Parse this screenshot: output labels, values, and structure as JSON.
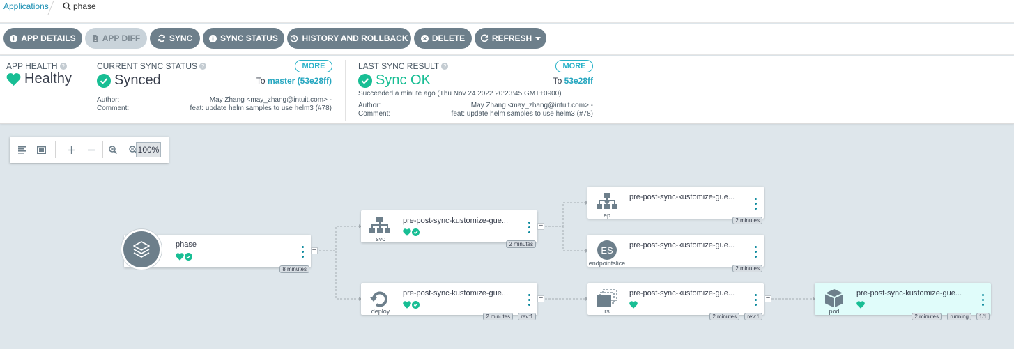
{
  "breadcrumb": {
    "applications": "Applications",
    "current": "phase"
  },
  "toolbar": {
    "app_details": "APP DETAILS",
    "app_diff": "APP DIFF",
    "sync": "SYNC",
    "sync_status": "SYNC STATUS",
    "history": "HISTORY AND ROLLBACK",
    "delete": "DELETE",
    "refresh": "REFRESH"
  },
  "health": {
    "title": "APP HEALTH",
    "value": "Healthy"
  },
  "current_sync": {
    "title": "CURRENT SYNC STATUS",
    "value": "Synced",
    "more": "MORE",
    "to_prefix": "To",
    "revision": "master (53e28ff)",
    "author_label": "Author:",
    "author": "May Zhang <may_zhang@intuit.com> -",
    "comment_label": "Comment:",
    "comment": "feat: update helm samples to use helm3 (#78)"
  },
  "last_sync": {
    "title": "LAST SYNC RESULT",
    "value": "Sync OK",
    "more": "MORE",
    "to_prefix": "To",
    "revision": "53e28ff",
    "succeeded": "Succeeded a minute ago (Thu Nov 24 2022 20:23:45 GMT+0900)",
    "author_label": "Author:",
    "author": "May Zhang <may_zhang@intuit.com> -",
    "comment_label": "Comment:",
    "comment": "feat: update helm samples to use helm3 (#78)"
  },
  "zoom": {
    "level": "100%"
  },
  "nodes": {
    "app": {
      "title": "phase",
      "age": "8 minutes"
    },
    "svc": {
      "title": "pre-post-sync-kustomize-gue...",
      "kind": "svc",
      "age": "2 minutes"
    },
    "deploy": {
      "title": "pre-post-sync-kustomize-gue...",
      "kind": "deploy",
      "age": "2 minutes",
      "rev": "rev:1"
    },
    "ep": {
      "title": "pre-post-sync-kustomize-gue...",
      "kind": "ep",
      "age": "2 minutes"
    },
    "es": {
      "title": "pre-post-sync-kustomize-gue...",
      "kind": "endpointslice",
      "badge": "ES",
      "age": "2 minutes"
    },
    "rs": {
      "title": "pre-post-sync-kustomize-gue...",
      "kind": "rs",
      "age": "2 minutes",
      "rev": "rev:1"
    },
    "pod": {
      "title": "pre-post-sync-kustomize-gue...",
      "kind": "pod",
      "age": "2 minutes",
      "state": "running",
      "ready": "1/1"
    }
  },
  "colors": {
    "healthy": "#18be94",
    "accent": "#27b2c8",
    "button": "#6d7f8b"
  },
  "icons": [
    "search-icon",
    "info-icon",
    "diff-icon",
    "sync-icon",
    "history-icon",
    "delete-icon",
    "refresh-icon",
    "heart-icon",
    "check-circle-icon",
    "layers-icon",
    "network-icon",
    "deploy-icon",
    "rs-icon",
    "pod-cube-icon"
  ]
}
